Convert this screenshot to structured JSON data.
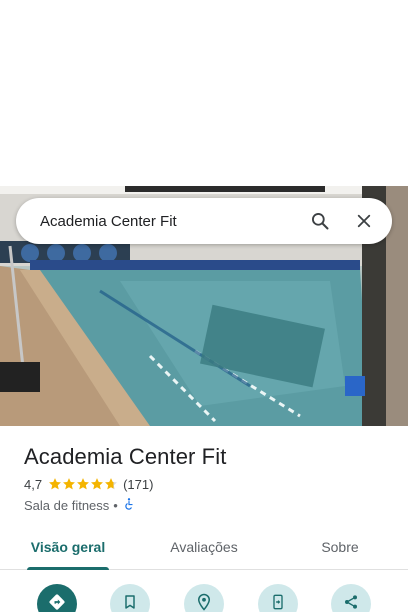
{
  "search": {
    "query": "Academia Center Fit"
  },
  "place": {
    "name": "Academia Center Fit",
    "rating": "4,7",
    "rating_value": 4.7,
    "reviews_count": "(171)",
    "category": "Sala de fitness",
    "separator": "•",
    "accessible": true
  },
  "tabs": [
    {
      "label": "Visão geral",
      "active": true
    },
    {
      "label": "Avaliações",
      "active": false
    },
    {
      "label": "Sobre",
      "active": false
    }
  ],
  "actions": [
    {
      "icon": "directions-icon"
    },
    {
      "icon": "bookmark-icon"
    },
    {
      "icon": "nearby-icon"
    },
    {
      "icon": "send-to-phone-icon"
    },
    {
      "icon": "share-icon"
    }
  ],
  "colors": {
    "accent": "#1b6d6c",
    "accent_light": "#cfe8ea",
    "star": "#f4b400",
    "accessibility": "#1a73e8"
  }
}
